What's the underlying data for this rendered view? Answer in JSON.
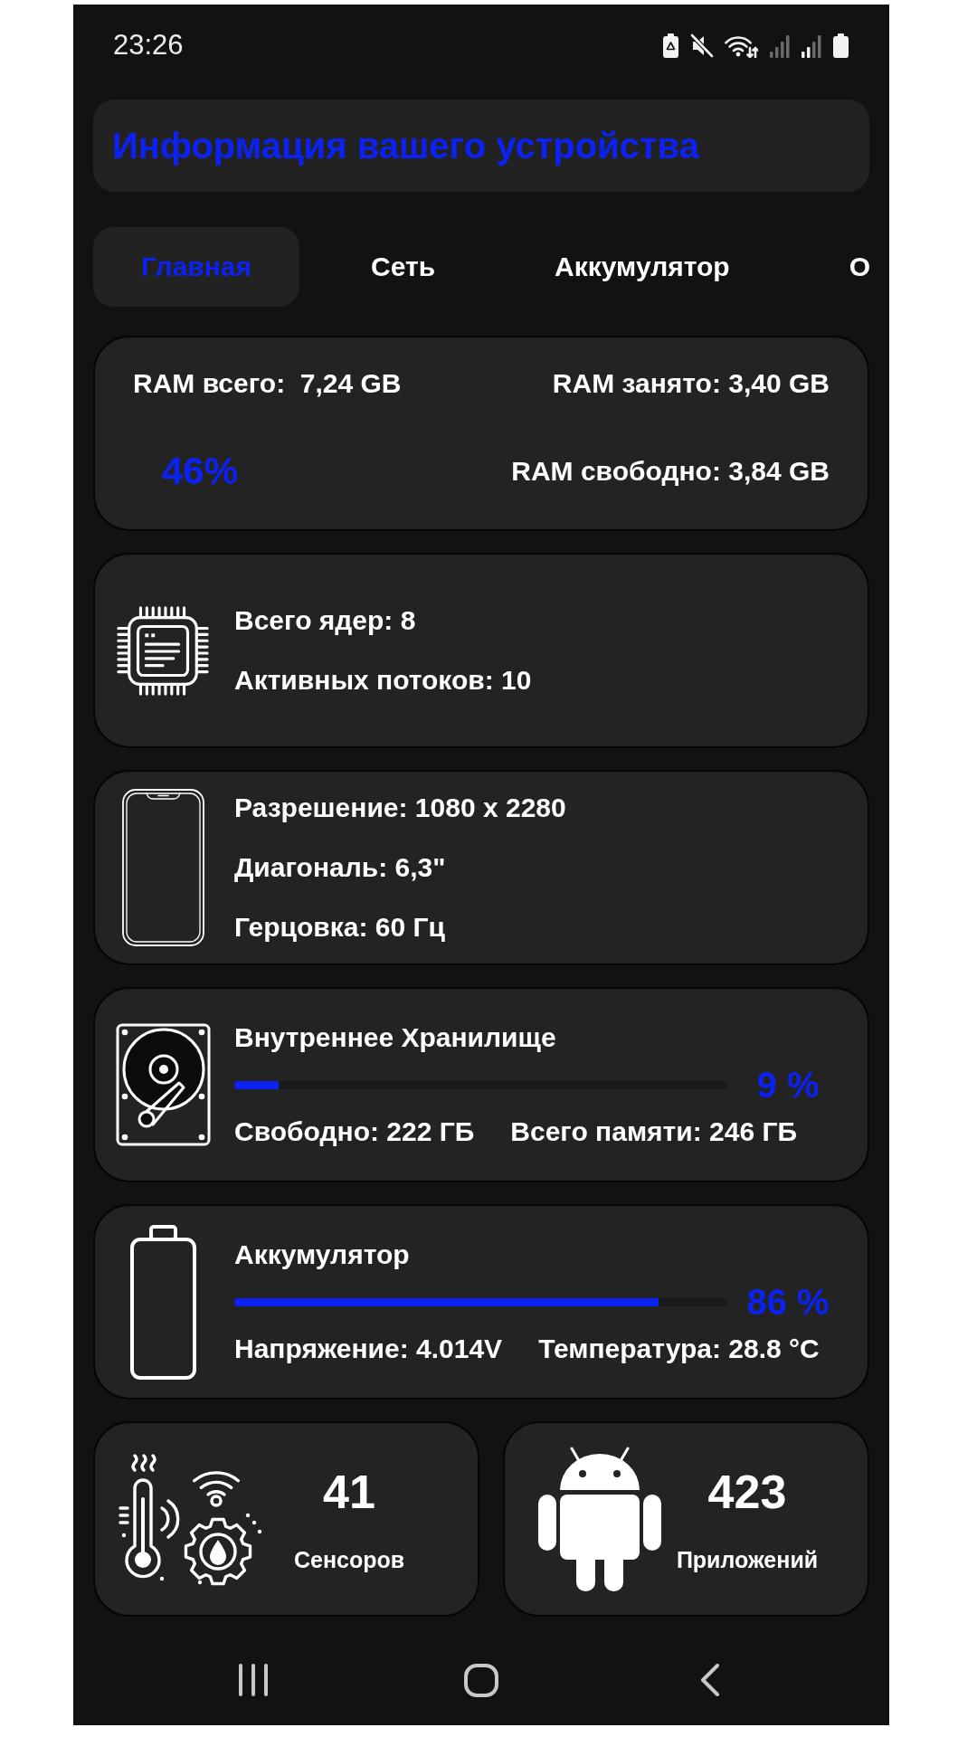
{
  "status_bar": {
    "time": "23:26"
  },
  "header": {
    "title": "Информация вашего устройства"
  },
  "tabs": [
    {
      "label": "Главная",
      "selected": true
    },
    {
      "label": "Сеть",
      "selected": false
    },
    {
      "label": "Аккумулятор",
      "selected": false
    },
    {
      "label": "О",
      "selected": false
    }
  ],
  "ram_card": {
    "total": "RAM всего:  7,24 GB",
    "used": "RAM занято: 3,40 GB",
    "percent": "46%",
    "free": "RAM свободно: 3,84 GB"
  },
  "cpu_card": {
    "lines": [
      "Всего ядер: 8",
      "Активных потоков: 10"
    ]
  },
  "display_card": {
    "lines": [
      "Разрешение: 1080 x 2280",
      "Диагональ: 6,3\"",
      "Герцовка: 60 Гц"
    ]
  },
  "storage_card": {
    "title": "Внутреннее Хранилище",
    "level": 0.09,
    "percent": "9 %",
    "free": "Свободно: 222 ГБ",
    "total": "Всего памяти: 246 ГБ"
  },
  "battery_card": {
    "title": "Аккумулятор",
    "level": 0.86,
    "percent": "86 %",
    "voltage": "Напряжение: 4.014V",
    "temperature": "Температура: 28.8 °C"
  },
  "tiles": [
    {
      "kind": "sensors",
      "count": "41",
      "label": "Сенсоров"
    },
    {
      "kind": "apps",
      "count": "423",
      "label": "Приложений"
    }
  ]
}
